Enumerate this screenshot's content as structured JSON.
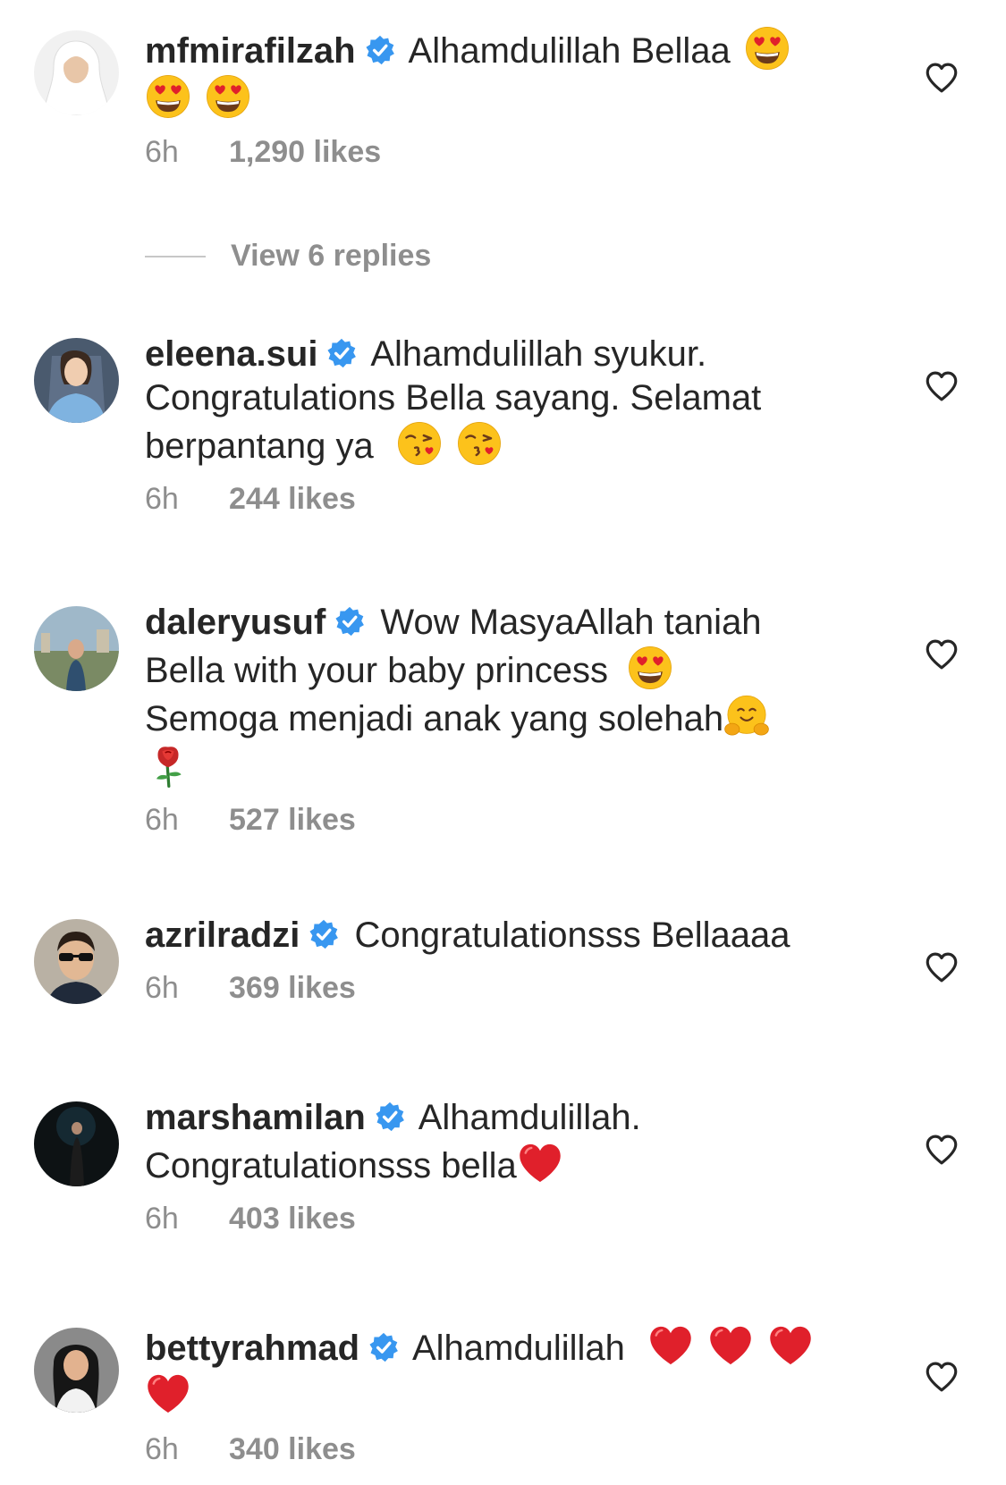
{
  "comments": [
    {
      "username": "mfmirafilzah",
      "text": "Alhamdulillah Bellaa",
      "emojis_inline": [
        "heart-eyes-emoji"
      ],
      "emojis_line2": [
        "heart-eyes-emoji",
        "heart-eyes-emoji"
      ],
      "time": "6h",
      "likes": "1,290 likes"
    },
    {
      "username": "eleena.sui",
      "text": "Alhamdulillah syukur. Congratulations Bella sayang. Selamat berpantang ya",
      "emojis": [
        "kiss-emoji",
        "kiss-emoji"
      ],
      "time": "6h",
      "likes": "244 likes"
    },
    {
      "username": "daleryusuf",
      "text_line1": "Wow MasyaAllah taniah",
      "text_line2": "Bella with your baby princess",
      "text_line3": "Semoga menjadi anak yang solehah",
      "emojis": [
        "heart-eyes-emoji",
        "hugging-emoji",
        "rose-emoji"
      ],
      "time": "6h",
      "likes": "527 likes"
    },
    {
      "username": "azrilradzi",
      "text": "Congratulationsss Bellaaaa",
      "time": "6h",
      "likes": "369 likes"
    },
    {
      "username": "marshamilan",
      "text_line1": "Alhamdulillah.",
      "text_line2": "Congratulationsss bella",
      "emojis": [
        "red-heart-emoji"
      ],
      "time": "6h",
      "likes": "403 likes"
    },
    {
      "username": "bettyrahmad",
      "text": "Alhamdulillah",
      "emojis": [
        "red-heart-emoji",
        "red-heart-emoji",
        "red-heart-emoji",
        "red-heart-emoji"
      ],
      "time": "6h",
      "likes": "340 likes"
    }
  ],
  "view_replies": "View 6 replies",
  "colors": {
    "text": "#262626",
    "muted": "#8e8e8e",
    "verified": "#3897f0",
    "heart_outline": "#262626",
    "emoji_face": "#fcc21b",
    "emoji_heart": "#e0202b"
  },
  "icons": {
    "verified": "verified-badge-icon",
    "like": "heart-outline-icon"
  }
}
